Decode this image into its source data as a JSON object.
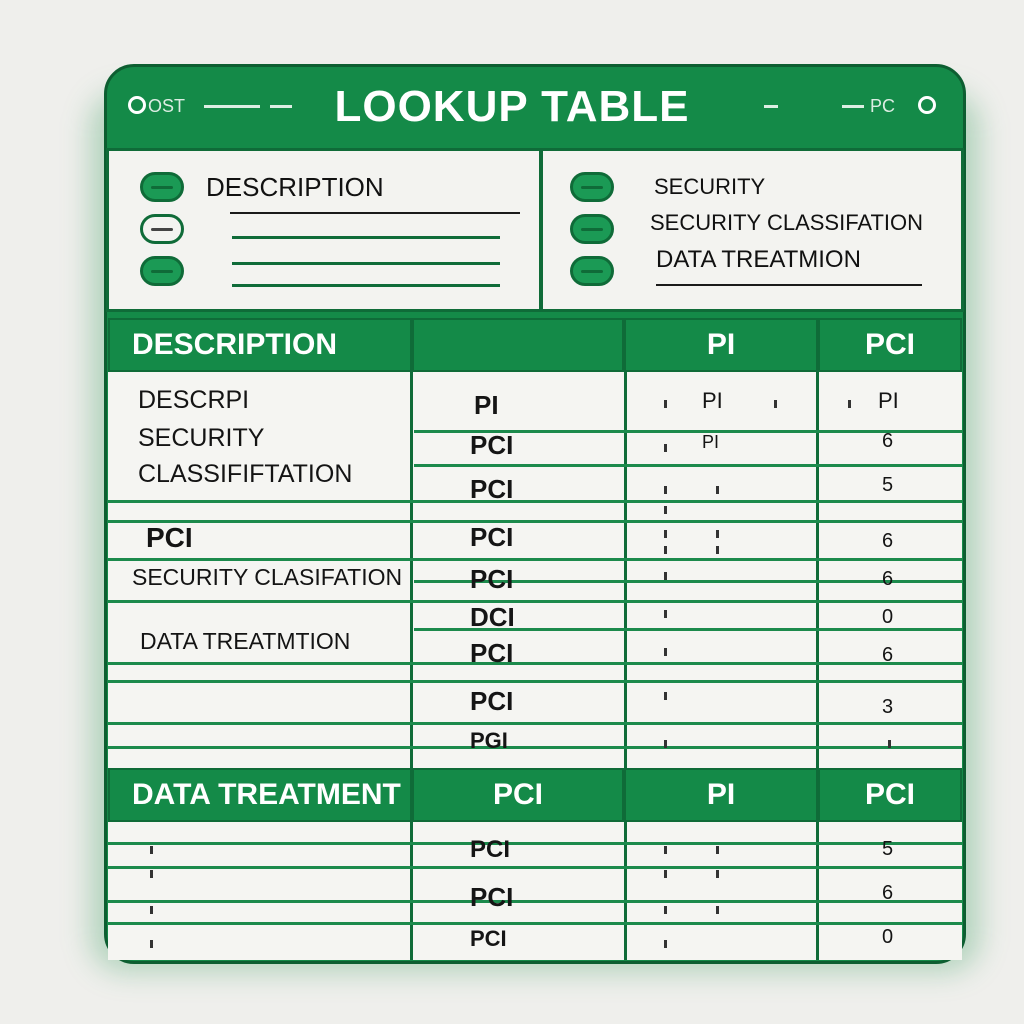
{
  "title": "LOOKUP TABLE",
  "titlebar": {
    "left_label": "OST",
    "right_label": "PC"
  },
  "legend_left": {
    "label": "DESCRIPTION"
  },
  "legend_right": {
    "items": [
      "SECURITY",
      "SECURITY CLASSIFATION",
      "DATA TREATMION"
    ]
  },
  "header1": {
    "col1": "DESCRIPTION",
    "col2": "",
    "col3": "PI",
    "col4": "PCI"
  },
  "desc_cells": [
    "DESCRPI",
    "SECURITY",
    "CLASSIFIFTATION",
    "PCI",
    "SECURITY CLASIFATION",
    "DATA TREATMTION"
  ],
  "col2_values": [
    "PI",
    "PCI",
    "PCI",
    "PCI",
    "PCI",
    "DCI",
    "PCI",
    "PCI",
    "PGI"
  ],
  "col3_values": [
    "PI",
    "PI"
  ],
  "col4_values": [
    "PI",
    "6",
    "5",
    "6",
    "6",
    "0",
    "6",
    "3",
    ""
  ],
  "header2": {
    "col1": "DATA TREATMENT",
    "col2": "PCI",
    "col3": "PI",
    "col4": "PCI"
  },
  "bottom_col2": [
    "PCI",
    "PCI",
    "PCI"
  ],
  "bottom_col4": [
    "5",
    "6",
    "0"
  ],
  "colors": {
    "green": "#148a48",
    "dark_green": "#0f6b38",
    "paper": "#f3f3f0"
  }
}
